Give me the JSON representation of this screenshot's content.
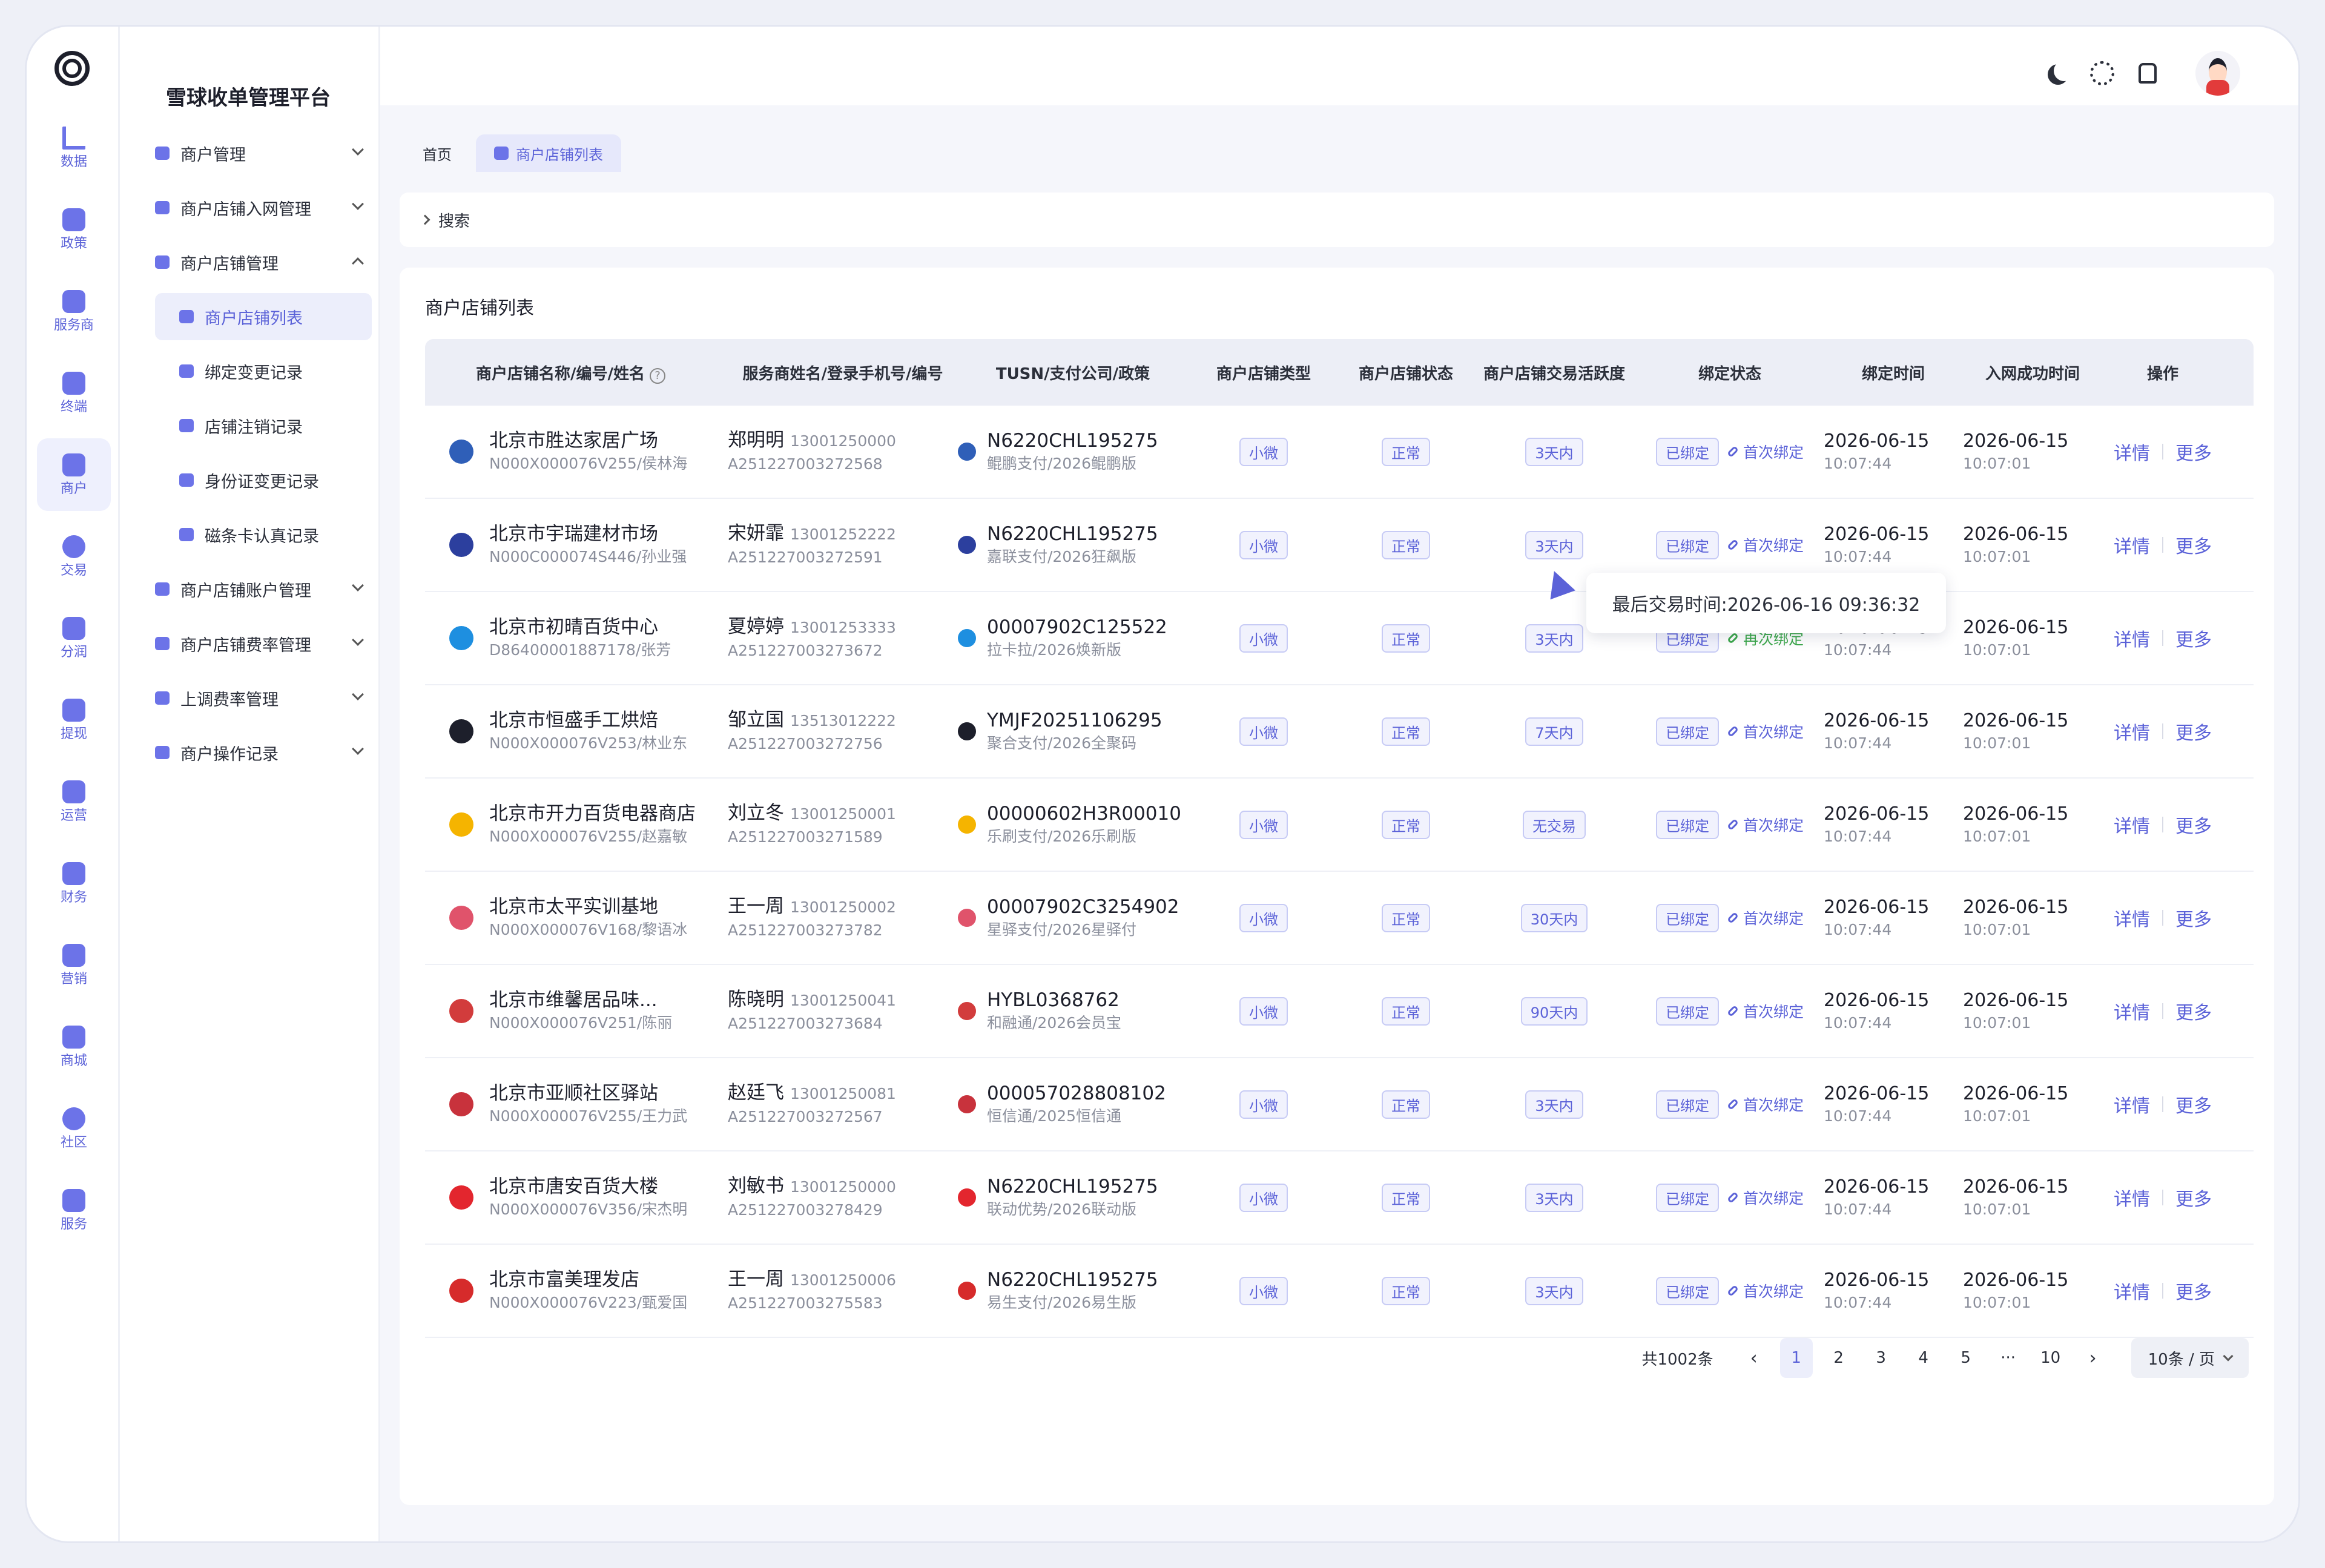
{
  "app": {
    "title": "雪球收单管理平台"
  },
  "rail": [
    {
      "label": "数据",
      "icon": "bar-chart-icon"
    },
    {
      "label": "政策",
      "icon": "grid-icon"
    },
    {
      "label": "服务商",
      "icon": "user-icon"
    },
    {
      "label": "终端",
      "icon": "pos-terminal-icon"
    },
    {
      "label": "商户",
      "icon": "store-icon",
      "active": true
    },
    {
      "label": "交易",
      "icon": "money-icon"
    },
    {
      "label": "分润",
      "icon": "money-bag-icon"
    },
    {
      "label": "提现",
      "icon": "wallet-icon"
    },
    {
      "label": "运营",
      "icon": "monitor-icon"
    },
    {
      "label": "财务",
      "icon": "shield-icon"
    },
    {
      "label": "营销",
      "icon": "gift-icon"
    },
    {
      "label": "商城",
      "icon": "shop-icon"
    },
    {
      "label": "社区",
      "icon": "chat-icon"
    },
    {
      "label": "服务",
      "icon": "heart-hands-icon"
    }
  ],
  "submenu": [
    {
      "label": "商户管理",
      "expanded": false
    },
    {
      "label": "商户店铺入网管理",
      "expanded": false
    },
    {
      "label": "商户店铺管理",
      "expanded": true
    },
    {
      "label": "商户店铺列表",
      "child": true,
      "active": true
    },
    {
      "label": "绑定变更记录",
      "child": true
    },
    {
      "label": "店铺注销记录",
      "child": true
    },
    {
      "label": "身份证变更记录",
      "child": true
    },
    {
      "label": "磁条卡认真记录",
      "child": true
    },
    {
      "label": "商户店铺账户管理",
      "expanded": false
    },
    {
      "label": "商户店铺费率管理",
      "expanded": false
    },
    {
      "label": "上调费率管理",
      "expanded": false
    },
    {
      "label": "商户操作记录",
      "expanded": false
    }
  ],
  "tabs": [
    {
      "label": "首页"
    },
    {
      "label": "商户店铺列表",
      "active": true
    }
  ],
  "search": {
    "label": "搜索"
  },
  "panel": {
    "title": "商户店铺列表"
  },
  "table": {
    "headers": [
      "商户店铺名称/编号/姓名",
      "服务商姓名/登录手机号/编号",
      "TUSN/支付公司/政策",
      "商户店铺类型",
      "商户店铺状态",
      "商户店铺交易活跃度",
      "绑定状态",
      "绑定时间",
      "入网成功时间",
      "操作"
    ],
    "rows": [
      {
        "name": "北京市胜达家居广场",
        "sub": "N000X000076V255/侯林海",
        "agent": "郑明明",
        "phone": "13001250000",
        "agent_id": "A251227003272568",
        "tusn": "N6220CHL195275",
        "policy": "鲲鹏支付/2026鲲鹏版",
        "type": "小微",
        "status": "正常",
        "activity": "3天内",
        "bind": "已绑定",
        "bind_note": "首次绑定",
        "bind_date": "2026-06-15",
        "bind_time": "10:07:44",
        "net_date": "2026-06-15",
        "net_time": "10:07:01",
        "logo_color": "#2f5fb8"
      },
      {
        "name": "北京市宇瑞建材市场",
        "sub": "N000C000074S446/孙业强",
        "agent": "宋妍霏",
        "phone": "13001252222",
        "agent_id": "A251227003272591",
        "tusn": "N6220CHL195275",
        "policy": "嘉联支付/2026狂飙版",
        "type": "小微",
        "status": "正常",
        "activity": "3天内",
        "bind": "已绑定",
        "bind_note": "首次绑定",
        "bind_date": "2026-06-15",
        "bind_time": "10:07:44",
        "net_date": "2026-06-15",
        "net_time": "10:07:01",
        "logo_color": "#2c3f9e"
      },
      {
        "name": "北京市初晴百货中心",
        "sub": "D86400001887178/张芳",
        "agent": "夏婷婷",
        "phone": "13001253333",
        "agent_id": "A251227003273672",
        "tusn": "00007902C125522",
        "policy": "拉卡拉/2026焕新版",
        "type": "小微",
        "status": "正常",
        "activity": "3天内",
        "bind": "已绑定",
        "bind_note": "再次绑定",
        "bind_date": "2026-06-15",
        "bind_time": "10:07:44",
        "net_date": "2026-06-15",
        "net_time": "10:07:01",
        "logo_color": "#1e8fe0"
      },
      {
        "name": "北京市恒盛手工烘焙",
        "sub": "N000X000076V253/林业东",
        "agent": "邹立国",
        "phone": "13513012222",
        "agent_id": "A251227003272756",
        "tusn": "YMJF20251106295",
        "policy": "聚合支付/2026全聚码",
        "type": "小微",
        "status": "正常",
        "activity": "7天内",
        "bind": "已绑定",
        "bind_note": "首次绑定",
        "bind_date": "2026-06-15",
        "bind_time": "10:07:44",
        "net_date": "2026-06-15",
        "net_time": "10:07:01",
        "logo_color": "#1d1f2b"
      },
      {
        "name": "北京市开力百货电器商店",
        "sub": "N000X000076V255/赵嘉敏",
        "agent": "刘立冬",
        "phone": "13001250001",
        "agent_id": "A251227003271589",
        "tusn": "00000602H3R00010",
        "policy": "乐刷支付/2026乐刷版",
        "type": "小微",
        "status": "正常",
        "activity": "无交易",
        "bind": "已绑定",
        "bind_note": "首次绑定",
        "bind_date": "2026-06-15",
        "bind_time": "10:07:44",
        "net_date": "2026-06-15",
        "net_time": "10:07:01",
        "logo_color": "#f5b400"
      },
      {
        "name": "北京市太平实训基地",
        "sub": "N000X000076V168/黎语冰",
        "agent": "王一周",
        "phone": "13001250002",
        "agent_id": "A251227003273782",
        "tusn": "00007902C3254902",
        "policy": "星驿支付/2026星驿付",
        "type": "小微",
        "status": "正常",
        "activity": "30天内",
        "bind": "已绑定",
        "bind_note": "首次绑定",
        "bind_date": "2026-06-15",
        "bind_time": "10:07:44",
        "net_date": "2026-06-15",
        "net_time": "10:07:01",
        "logo_color": "#e0536b"
      },
      {
        "name": "北京市维馨居品味...",
        "sub": "N000X000076V251/陈丽",
        "agent": "陈晓明",
        "phone": "13001250041",
        "agent_id": "A251227003273684",
        "tusn": "HYBL0368762",
        "policy": "和融通/2026会员宝",
        "type": "小微",
        "status": "正常",
        "activity": "90天内",
        "bind": "已绑定",
        "bind_note": "首次绑定",
        "bind_date": "2026-06-15",
        "bind_time": "10:07:44",
        "net_date": "2026-06-15",
        "net_time": "10:07:01",
        "logo_color": "#d23c3c"
      },
      {
        "name": "北京市亚顺社区驿站",
        "sub": "N000X000076V255/王力武",
        "agent": "赵廷飞",
        "phone": "13001250081",
        "agent_id": "A251227003272567",
        "tusn": "000057028808102",
        "policy": "恒信通/2025恒信通",
        "type": "小微",
        "status": "正常",
        "activity": "3天内",
        "bind": "已绑定",
        "bind_note": "首次绑定",
        "bind_date": "2026-06-15",
        "bind_time": "10:07:44",
        "net_date": "2026-06-15",
        "net_time": "10:07:01",
        "logo_color": "#c8323c"
      },
      {
        "name": "北京市唐安百货大楼",
        "sub": "N000X000076V356/宋杰明",
        "agent": "刘敏书",
        "phone": "13001250000",
        "agent_id": "A251227003278429",
        "tusn": "N6220CHL195275",
        "policy": "联动优势/2026联动版",
        "type": "小微",
        "status": "正常",
        "activity": "3天内",
        "bind": "已绑定",
        "bind_note": "首次绑定",
        "bind_date": "2026-06-15",
        "bind_time": "10:07:44",
        "net_date": "2026-06-15",
        "net_time": "10:07:01",
        "logo_color": "#e3262e"
      },
      {
        "name": "北京市富美理发店",
        "sub": "N000X000076V223/甄爱国",
        "agent": "王一周",
        "phone": "13001250006",
        "agent_id": "A251227003275583",
        "tusn": "N6220CHL195275",
        "policy": "易生支付/2026易生版",
        "type": "小微",
        "status": "正常",
        "activity": "3天内",
        "bind": "已绑定",
        "bind_note": "首次绑定",
        "bind_date": "2026-06-15",
        "bind_time": "10:07:44",
        "net_date": "2026-06-15",
        "net_time": "10:07:01",
        "logo_color": "#d62b2b"
      }
    ],
    "ops": {
      "detail": "详情",
      "more": "更多"
    }
  },
  "tooltip": {
    "text": "最后交易时间:2026-06-16 09:36:32"
  },
  "pagination": {
    "total": "共1002条",
    "prev": "‹",
    "next": "›",
    "pages": [
      "1",
      "2",
      "3",
      "4",
      "5",
      "···",
      "10"
    ],
    "current": "1",
    "page_size": "10条 / 页"
  },
  "colors": {
    "accent": "#5b62d8",
    "green": "#3ca84b"
  }
}
